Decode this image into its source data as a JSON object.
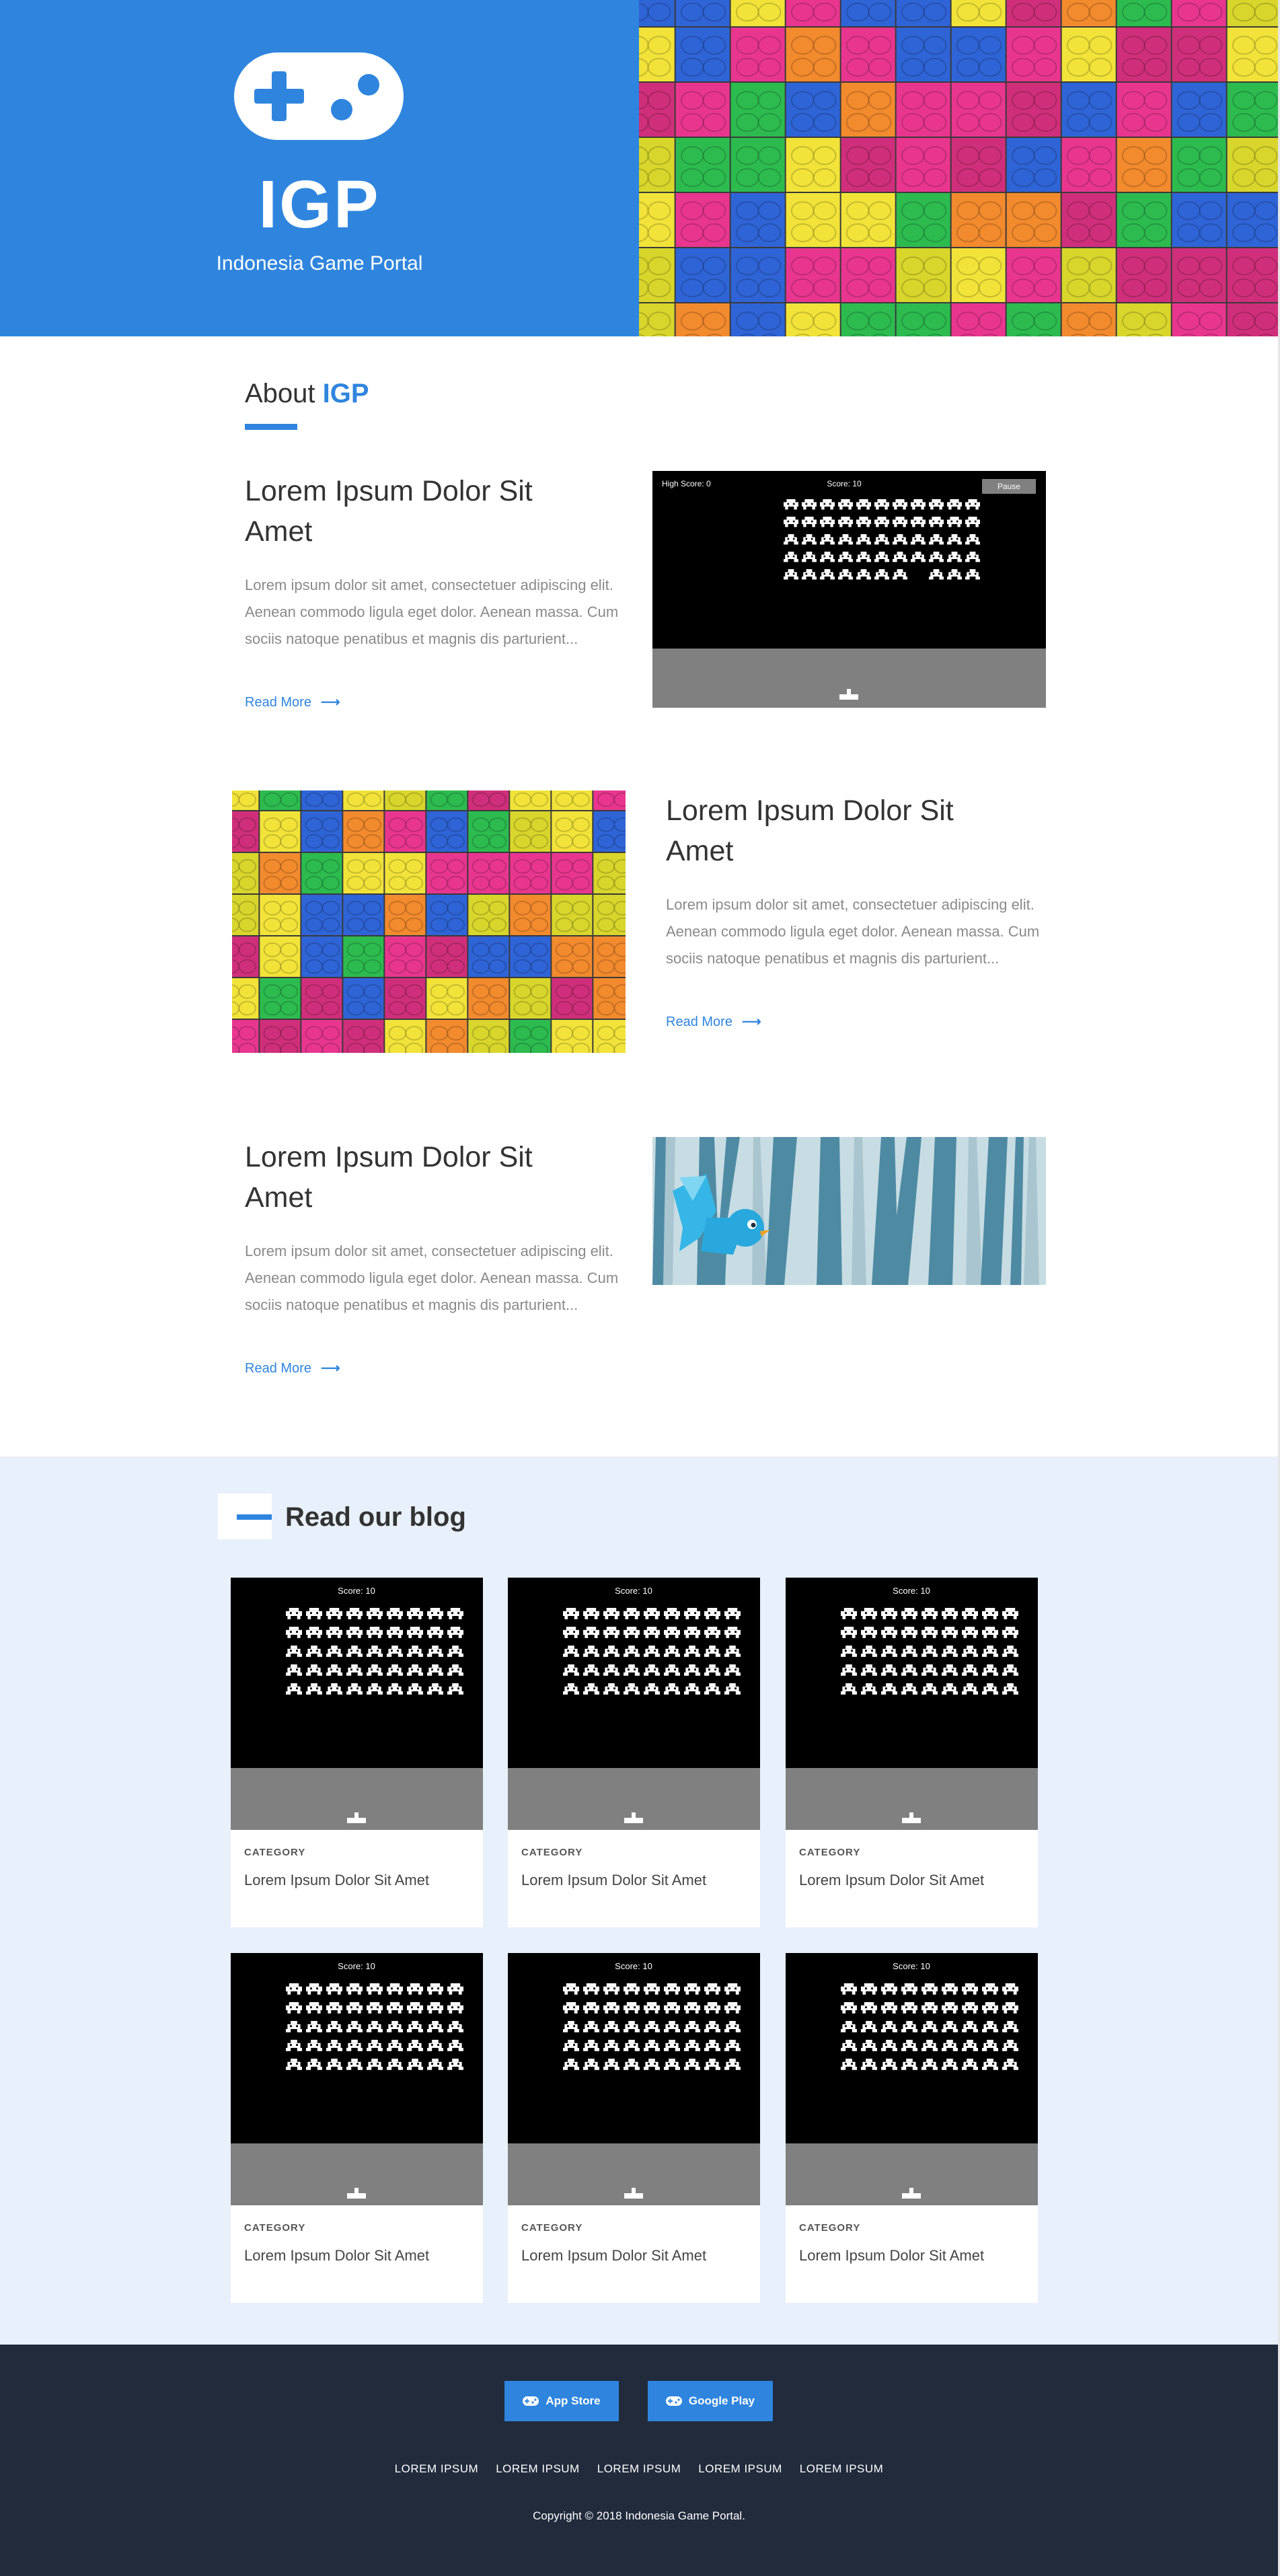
{
  "hero": {
    "brand": "IGP",
    "subtitle": "Indonesia Game Portal"
  },
  "about": {
    "heading_prefix": "About ",
    "heading_accent": "IGP",
    "features": [
      {
        "title": "Lorem Ipsum Dolor Sit Amet",
        "text": "Lorem ipsum dolor sit amet, consectetuer adipiscing elit. Aenean commodo ligula eget dolor. Aenean massa. Cum sociis natoque penatibus et magnis dis parturient...",
        "link": "Read More"
      },
      {
        "title": "Lorem Ipsum Dolor Sit Amet",
        "text": "Lorem ipsum dolor sit amet, consectetuer adipiscing elit. Aenean commodo ligula eget dolor. Aenean massa. Cum sociis natoque penatibus et magnis dis parturient...",
        "link": "Read More"
      },
      {
        "title": "Lorem Ipsum Dolor Sit Amet",
        "text": "Lorem ipsum dolor sit amet, consectetuer adipiscing elit. Aenean commodo ligula eget dolor. Aenean massa. Cum sociis natoque penatibus et magnis dis parturient...",
        "link": "Read More"
      }
    ],
    "game_shot": {
      "high_score": "High Score: 0",
      "score": "Score: 10",
      "pause": "Pause"
    }
  },
  "blog": {
    "heading": "Read our blog",
    "cards": [
      {
        "category": "CATEGORY",
        "title": "Lorem Ipsum Dolor Sit Amet",
        "score": "Score: 10"
      },
      {
        "category": "CATEGORY",
        "title": "Lorem Ipsum Dolor Sit Amet",
        "score": "Score: 10"
      },
      {
        "category": "CATEGORY",
        "title": "Lorem Ipsum Dolor Sit Amet",
        "score": "Score: 10"
      },
      {
        "category": "CATEGORY",
        "title": "Lorem Ipsum Dolor Sit Amet",
        "score": "Score: 10"
      },
      {
        "category": "CATEGORY",
        "title": "Lorem Ipsum Dolor Sit Amet",
        "score": "Score: 10"
      },
      {
        "category": "CATEGORY",
        "title": "Lorem Ipsum Dolor Sit Amet",
        "score": "Score: 10"
      }
    ]
  },
  "footer": {
    "app_store": "App Store",
    "google_play": "Google Play",
    "links": [
      "LOREM IPSUM",
      "LOREM IPSUM",
      "LOREM IPSUM",
      "LOREM IPSUM",
      "LOREM IPSUM"
    ],
    "copyright": "Copyright © 2018 Indonesia Game Portal."
  },
  "colors": {
    "accent": "#2f85de",
    "footer_bg": "#212b3c",
    "blog_bg": "#e8f0fb"
  },
  "icons": [
    "gamepad-icon",
    "arrow-right-icon",
    "space-invader-icon",
    "cannon-icon",
    "bird-icon"
  ]
}
